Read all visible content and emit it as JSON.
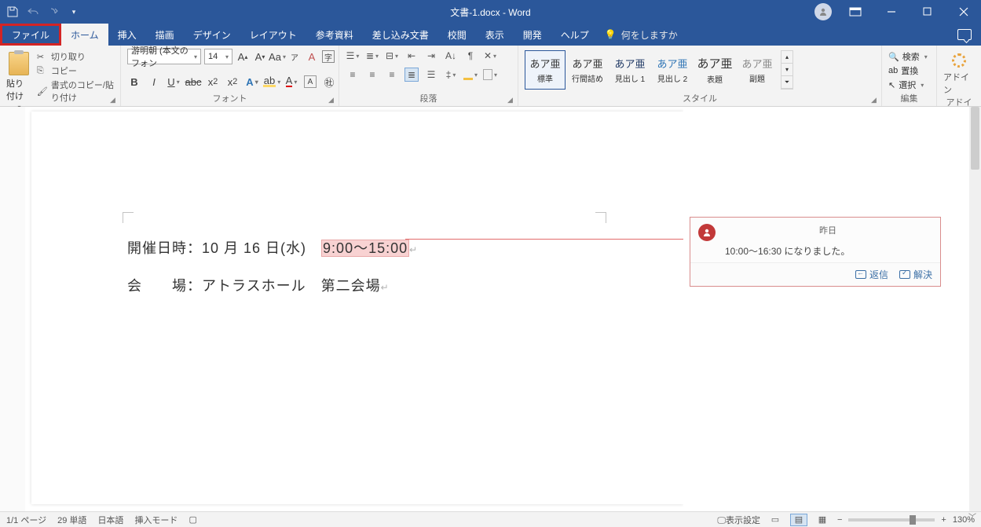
{
  "title": "文書-1.docx - Word",
  "tabs": {
    "file": "ファイル",
    "home": "ホーム",
    "insert": "挿入",
    "draw": "描画",
    "design": "デザイン",
    "layout": "レイアウト",
    "references": "参考資料",
    "mailings": "差し込み文書",
    "review": "校閲",
    "view": "表示",
    "developer": "開発",
    "help": "ヘルプ",
    "tellme": "何をしますか"
  },
  "ribbon": {
    "clipboard": {
      "label": "クリップボード",
      "paste": "貼り付け",
      "cut": "切り取り",
      "copy": "コピー",
      "format_painter": "書式のコピー/貼り付け"
    },
    "font": {
      "label": "フォント",
      "name": "游明朝 (本文のフォン",
      "size": "14"
    },
    "paragraph": {
      "label": "段落"
    },
    "styles": {
      "label": "スタイル",
      "items": [
        {
          "sample": "あア亜",
          "name": "標準"
        },
        {
          "sample": "あア亜",
          "name": "行間詰め"
        },
        {
          "sample": "あア亜",
          "name": "見出し 1"
        },
        {
          "sample": "あア亜",
          "name": "見出し 2"
        },
        {
          "sample": "あア亜",
          "name": "表題"
        },
        {
          "sample": "あア亜",
          "name": "副題"
        }
      ]
    },
    "editing": {
      "label": "編集",
      "find": "検索",
      "replace": "置換",
      "select": "選択"
    },
    "addins": {
      "label": "アドイン",
      "btn": "アドイン"
    }
  },
  "document": {
    "line1_a": "開催日時：10 月 16 日(水)　",
    "line1_b": "9:00～15:00",
    "line2": "会　　場：アトラスホール　第二会場"
  },
  "comment": {
    "date": "昨日",
    "text": "10:00～16:30 になりました。",
    "reply": "返信",
    "resolve": "解決"
  },
  "status": {
    "page": "1/1 ページ",
    "words": "29 単語",
    "lang": "日本語",
    "mode": "挿入モード",
    "display": "表示設定",
    "zoom": "130%"
  }
}
